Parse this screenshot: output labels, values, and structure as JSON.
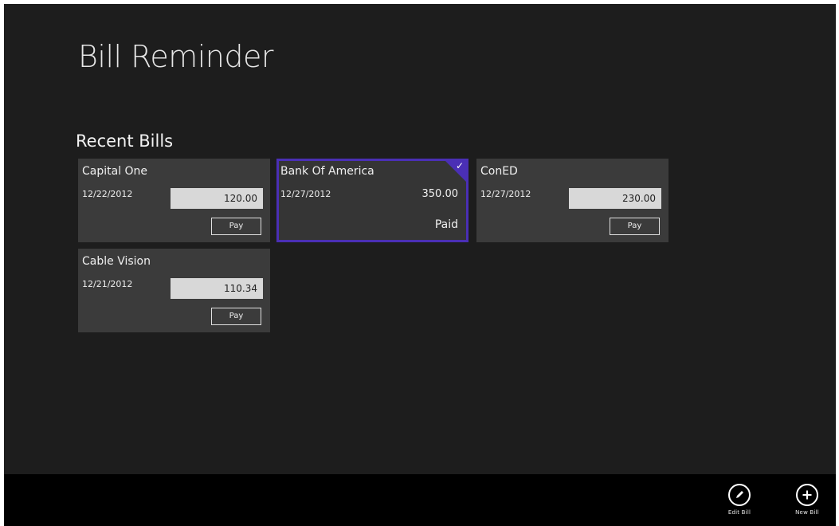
{
  "app": {
    "title": "Bill Reminder"
  },
  "section": {
    "title": "Recent Bills"
  },
  "bills": [
    {
      "name": "Capital One",
      "date": "12/22/2012",
      "amount": "120.00",
      "pay_label": "Pay"
    },
    {
      "name": "Bank Of America",
      "date": "12/27/2012",
      "amount": "350.00",
      "status": "Paid",
      "selected": true
    },
    {
      "name": "ConED",
      "date": "12/27/2012",
      "amount": "230.00",
      "pay_label": "Pay"
    },
    {
      "name": "Cable Vision",
      "date": "12/21/2012",
      "amount": "110.34",
      "pay_label": "Pay"
    }
  ],
  "app_bar": {
    "edit_label": "Edit Bill",
    "new_label": "New Bill"
  },
  "icons": {
    "edit": "pencil-icon",
    "new": "plus-icon",
    "selected": "checkmark-icon"
  },
  "colors": {
    "background": "#1d1d1d",
    "tile": "#3b3b3b",
    "accent": "#4a2fb5",
    "app_bar": "#000000"
  }
}
